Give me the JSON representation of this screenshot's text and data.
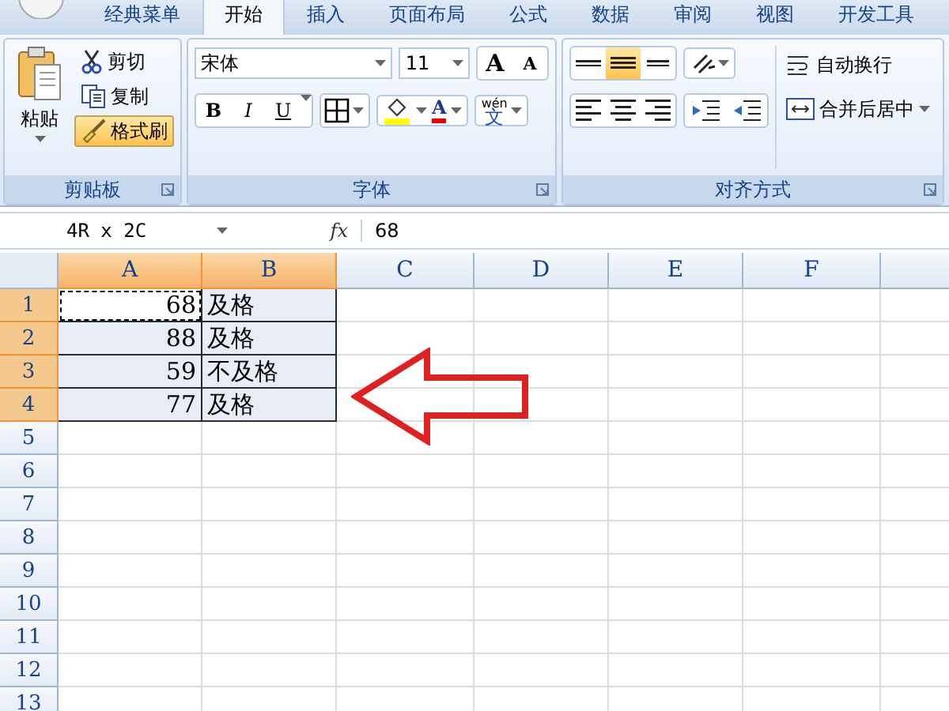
{
  "tabs": [
    {
      "label": "经典菜单",
      "selected": false
    },
    {
      "label": "开始",
      "selected": true
    },
    {
      "label": "插入",
      "selected": false
    },
    {
      "label": "页面布局",
      "selected": false
    },
    {
      "label": "公式",
      "selected": false
    },
    {
      "label": "数据",
      "selected": false
    },
    {
      "label": "审阅",
      "selected": false
    },
    {
      "label": "视图",
      "selected": false
    },
    {
      "label": "开发工具",
      "selected": false
    }
  ],
  "clipboard": {
    "paste": "粘贴",
    "items": [
      {
        "kind": "cut",
        "label": "剪切",
        "selected": false
      },
      {
        "kind": "copy",
        "label": "复制",
        "selected": false
      },
      {
        "kind": "painter",
        "label": "格式刷",
        "selected": true
      }
    ],
    "group_label": "剪贴板"
  },
  "font": {
    "name": "宋体",
    "size": "11",
    "grow": "A",
    "shrink": "A",
    "bold": "B",
    "italic": "I",
    "underline": "U",
    "font_color": "A",
    "phonetic_top": "wén",
    "phonetic": "文",
    "group_label": "字体"
  },
  "alignment": {
    "vertical": [
      {
        "kind": "top",
        "selected": false
      },
      {
        "kind": "middle",
        "selected": true
      },
      {
        "kind": "bottom",
        "selected": false
      }
    ],
    "horizontal": [
      {
        "kind": "left",
        "selected": false
      },
      {
        "kind": "center",
        "selected": false
      },
      {
        "kind": "right",
        "selected": false
      }
    ],
    "wrap": "自动换行",
    "merge": "合并后居中",
    "group_label": "对齐方式"
  },
  "formula_bar": {
    "name_box": "4R  x  2C",
    "fx": "fx",
    "value": "68"
  },
  "sheet": {
    "columns": [
      {
        "label": "A",
        "selected": true
      },
      {
        "label": "B",
        "selected": true
      },
      {
        "label": "C",
        "selected": false
      },
      {
        "label": "D",
        "selected": false
      },
      {
        "label": "E",
        "selected": false
      },
      {
        "label": "F",
        "selected": false
      }
    ],
    "rows": [
      {
        "header": "1",
        "selected": true,
        "cells": [
          {
            "text": "68",
            "active": true,
            "marquee": true
          },
          {
            "text": "及格",
            "active": false,
            "marquee": false
          }
        ]
      },
      {
        "header": "2",
        "selected": true,
        "cells": [
          {
            "text": "88",
            "active": false,
            "marquee": false
          },
          {
            "text": "及格",
            "active": false,
            "marquee": false
          }
        ]
      },
      {
        "header": "3",
        "selected": true,
        "cells": [
          {
            "text": "59",
            "active": false,
            "marquee": false
          },
          {
            "text": "不及格",
            "active": false,
            "marquee": false
          }
        ]
      },
      {
        "header": "4",
        "selected": true,
        "cells": [
          {
            "text": "77",
            "active": false,
            "marquee": false
          },
          {
            "text": "及格",
            "active": false,
            "marquee": false
          }
        ]
      },
      {
        "header": "5",
        "selected": false,
        "cells": []
      },
      {
        "header": "6",
        "selected": false,
        "cells": []
      },
      {
        "header": "7",
        "selected": false,
        "cells": []
      },
      {
        "header": "8",
        "selected": false,
        "cells": []
      },
      {
        "header": "9",
        "selected": false,
        "cells": []
      },
      {
        "header": "10",
        "selected": false,
        "cells": []
      },
      {
        "header": "11",
        "selected": false,
        "cells": []
      },
      {
        "header": "12",
        "selected": false,
        "cells": []
      },
      {
        "header": "13",
        "selected": false,
        "cells": []
      }
    ]
  }
}
